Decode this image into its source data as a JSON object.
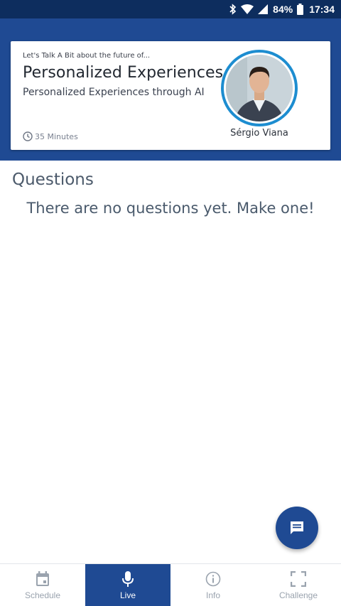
{
  "status_bar": {
    "battery": "84%",
    "time": "17:34"
  },
  "talk": {
    "kicker": "Let's Talk A Bit about the future of...",
    "title": "Personalized Experiences",
    "subtitle": "Personalized Experiences through AI",
    "duration": "35 Minutes",
    "speaker": "Sérgio Viana"
  },
  "questions": {
    "heading": "Questions",
    "empty_message": "There are no questions yet. Make one!"
  },
  "nav": {
    "items": [
      {
        "label": "Schedule",
        "icon": "calendar-icon",
        "active": false
      },
      {
        "label": "Live",
        "icon": "microphone-icon",
        "active": true
      },
      {
        "label": "Info",
        "icon": "info-icon",
        "active": false
      },
      {
        "label": "Challenge",
        "icon": "scan-frame-icon",
        "active": false
      }
    ]
  },
  "fab": {
    "icon": "chat-bubble-icon"
  },
  "colors": {
    "header": "#1f4a93",
    "status_bar": "#0d2d5e",
    "avatar_ring": "#1d8dd0"
  }
}
